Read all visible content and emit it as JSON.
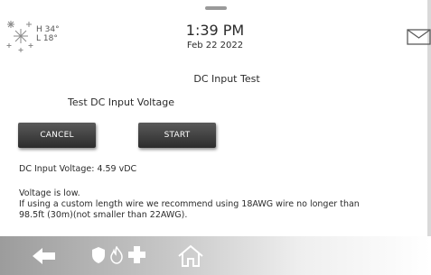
{
  "weather": {
    "icon": "snowflakes-icon",
    "high": "H 34°",
    "low": "L 18°"
  },
  "clock": {
    "time": "1:39 PM",
    "date": "Feb 22 2022"
  },
  "header": {
    "mail_icon": "envelope-icon"
  },
  "screen": {
    "title": "DC Input Test",
    "section_heading": "Test DC Input Voltage"
  },
  "buttons": {
    "cancel": "CANCEL",
    "start": "START"
  },
  "reading": {
    "voltage_line": "DC Input Voltage: 4.59 vDC"
  },
  "message": {
    "line1": "Voltage is low.",
    "line2": "If using a custom length wire we recommend using 18AWG wire no longer than",
    "line3": "98.5ft (30m)(not smaller than 22AWG)."
  },
  "bottom_bar": {
    "icons": [
      "back-arrow-icon",
      "shield-icon",
      "fire-icon",
      "medical-cross-icon",
      "home-icon"
    ]
  },
  "colors": {
    "button_bg": "#3a3a3a",
    "button_text": "#ffffff",
    "text": "#2b2b2b"
  }
}
